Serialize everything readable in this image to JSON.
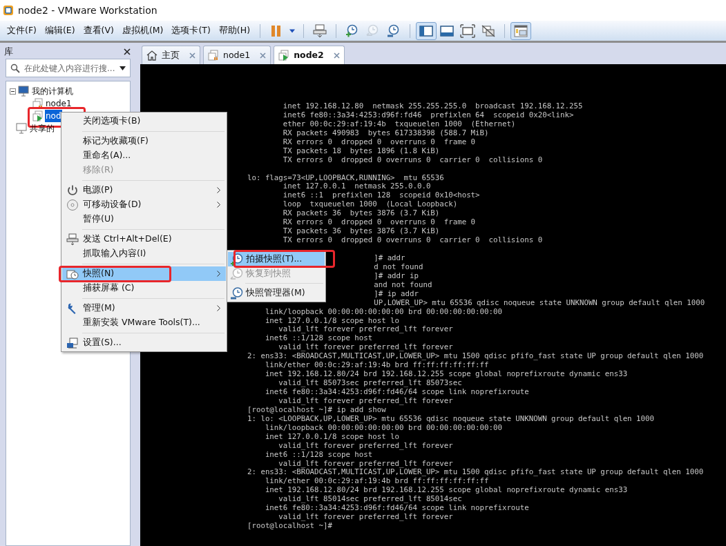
{
  "window": {
    "title": "node2 - VMware Workstation"
  },
  "menu_bar": [
    "文件(F)",
    "编辑(E)",
    "查看(V)",
    "虚拟机(M)",
    "选项卡(T)",
    "帮助(H)"
  ],
  "toolbar_groups": [
    [
      {
        "pressed": false,
        "disabled": false
      },
      {
        "pressed": false,
        "disabled": false
      }
    ],
    [
      {
        "pressed": false,
        "disabled": false
      }
    ],
    [
      {
        "pressed": false,
        "disabled": false
      },
      {
        "pressed": false,
        "disabled": true
      },
      {
        "pressed": false,
        "disabled": false
      }
    ],
    [
      {
        "pressed": true,
        "disabled": false
      },
      {
        "pressed": false,
        "disabled": false
      },
      {
        "pressed": false,
        "disabled": false
      },
      {
        "pressed": false,
        "disabled": false
      }
    ],
    [
      {
        "pressed": true,
        "disabled": false
      }
    ]
  ],
  "library": {
    "title": "库",
    "search": {
      "placeholder": "在此处键入内容进行搜..."
    },
    "tree": [
      {
        "label": "我的计算机",
        "expanded": true,
        "selected": false,
        "highlighted": false,
        "children": [
          {
            "label": "node1",
            "selected": false,
            "highlighted": false,
            "running": false
          },
          {
            "label": "nod",
            "selected": true,
            "highlighted": true,
            "running": true
          }
        ]
      },
      {
        "label": "共享的",
        "selected": false,
        "highlighted": false
      }
    ]
  },
  "tabs": [
    {
      "label": "主页",
      "selected": false
    },
    {
      "label": "node1",
      "selected": false
    },
    {
      "label": "node2",
      "selected": true
    }
  ],
  "terminal": [
    {
      "kind": "line",
      "text": "        inet 192.168.12.80  netmask 255.255.255.0  broadcast 192.168.12.255"
    },
    {
      "kind": "line",
      "text": "        inet6 fe80::3a34:4253:d96f:fd46  prefixlen 64  scopeid 0x20<link>"
    },
    {
      "kind": "line",
      "text": "        ether 00:0c:29:af:19:4b  txqueuelen 1000  (Ethernet)"
    },
    {
      "kind": "line",
      "text": "        RX packets 490983  bytes 617338398 (588.7 MiB)"
    },
    {
      "kind": "line",
      "text": "        RX errors 0  dropped 0  overruns 0  frame 0"
    },
    {
      "kind": "line",
      "text": "        TX packets 18  bytes 1896 (1.8 KiB)"
    },
    {
      "kind": "line",
      "text": "        TX errors 0  dropped 0 overruns 0  carrier 0  collisions 0"
    },
    {
      "kind": "blank"
    },
    {
      "kind": "line",
      "text": "lo: flags=73<UP,LOOPBACK,RUNNING>  mtu 65536"
    },
    {
      "kind": "line",
      "text": "        inet 127.0.0.1  netmask 255.0.0.0"
    },
    {
      "kind": "line",
      "text": "        inet6 ::1  prefixlen 128  scopeid 0x10<host>"
    },
    {
      "kind": "line",
      "text": "        loop  txqueuelen 1000  (Local Loopback)"
    },
    {
      "kind": "line",
      "text": "        RX packets 36  bytes 3876 (3.7 KiB)"
    },
    {
      "kind": "line",
      "text": "        RX errors 0  dropped 0  overruns 0  frame 0"
    },
    {
      "kind": "line",
      "text": "        TX packets 36  bytes 3876 (3.7 KiB)"
    },
    {
      "kind": "line",
      "text": "        TX errors 0  dropped 0 overruns 0  carrier 0  collisions 0"
    },
    {
      "kind": "blank"
    },
    {
      "kind": "covered",
      "text": "]# addr"
    },
    {
      "kind": "covered",
      "text": "d not found"
    },
    {
      "kind": "covered",
      "text": "]# addr ip"
    },
    {
      "kind": "covered",
      "text": "and not found"
    },
    {
      "kind": "covered",
      "text": "]# ip addr"
    },
    {
      "kind": "covered",
      "text": "UP,LOWER_UP> mtu 65536 qdisc noqueue state UNKNOWN group default qlen 1000"
    },
    {
      "kind": "line",
      "text": "    link/loopback 00:00:00:00:00:00 brd 00:00:00:00:00:00"
    },
    {
      "kind": "line",
      "text": "    inet 127.0.0.1/8 scope host lo"
    },
    {
      "kind": "line",
      "text": "       valid_lft forever preferred_lft forever"
    },
    {
      "kind": "line",
      "text": "    inet6 ::1/128 scope host"
    },
    {
      "kind": "line",
      "text": "       valid_lft forever preferred_lft forever"
    },
    {
      "kind": "line",
      "text": "2: ens33: <BROADCAST,MULTICAST,UP,LOWER_UP> mtu 1500 qdisc pfifo_fast state UP group default qlen 1000"
    },
    {
      "kind": "line",
      "text": "    link/ether 00:0c:29:af:19:4b brd ff:ff:ff:ff:ff:ff"
    },
    {
      "kind": "line",
      "text": "    inet 192.168.12.80/24 brd 192.168.12.255 scope global noprefixroute dynamic ens33"
    },
    {
      "kind": "line",
      "text": "       valid_lft 85073sec preferred_lft 85073sec"
    },
    {
      "kind": "line",
      "text": "    inet6 fe80::3a34:4253:d96f:fd46/64 scope link noprefixroute"
    },
    {
      "kind": "line",
      "text": "       valid_lft forever preferred_lft forever"
    },
    {
      "kind": "line",
      "text": "[root@localhost ~]# ip add show"
    },
    {
      "kind": "line",
      "text": "1: lo: <LOOPBACK,UP,LOWER_UP> mtu 65536 qdisc noqueue state UNKNOWN group default qlen 1000"
    },
    {
      "kind": "line",
      "text": "    link/loopback 00:00:00:00:00:00 brd 00:00:00:00:00:00"
    },
    {
      "kind": "line",
      "text": "    inet 127.0.0.1/8 scope host lo"
    },
    {
      "kind": "line",
      "text": "       valid_lft forever preferred_lft forever"
    },
    {
      "kind": "line",
      "text": "    inet6 ::1/128 scope host"
    },
    {
      "kind": "line",
      "text": "       valid_lft forever preferred_lft forever"
    },
    {
      "kind": "line",
      "text": "2: ens33: <BROADCAST,MULTICAST,UP,LOWER_UP> mtu 1500 qdisc pfifo_fast state UP group default qlen 1000"
    },
    {
      "kind": "line",
      "text": "    link/ether 00:0c:29:af:19:4b brd ff:ff:ff:ff:ff:ff"
    },
    {
      "kind": "line",
      "text": "    inet 192.168.12.80/24 brd 192.168.12.255 scope global noprefixroute dynamic ens33"
    },
    {
      "kind": "line",
      "text": "       valid_lft 85014sec preferred_lft 85014sec"
    },
    {
      "kind": "line",
      "text": "    inet6 fe80::3a34:4253:d96f:fd46/64 scope link noprefixroute"
    },
    {
      "kind": "line",
      "text": "       valid_lft forever preferred_lft forever"
    },
    {
      "kind": "line",
      "text": "[root@localhost ~]#"
    }
  ],
  "context_menu": {
    "groups": [
      [
        {
          "label": "关闭选项卡(B)",
          "disabled": false,
          "submenu": false,
          "selected": false,
          "highlighted": false
        }
      ],
      [
        {
          "label": "标记为收藏项(F)",
          "disabled": false,
          "submenu": false,
          "selected": false,
          "highlighted": false
        },
        {
          "label": "重命名(A)...",
          "disabled": false,
          "submenu": false,
          "selected": false,
          "highlighted": false
        },
        {
          "label": "移除(R)",
          "disabled": true,
          "submenu": false,
          "selected": false,
          "highlighted": false
        }
      ],
      [
        {
          "label": "电源(P)",
          "disabled": false,
          "submenu": true,
          "selected": false,
          "highlighted": false
        },
        {
          "label": "可移动设备(D)",
          "disabled": false,
          "submenu": true,
          "selected": false,
          "highlighted": false
        },
        {
          "label": "暂停(U)",
          "disabled": false,
          "submenu": false,
          "selected": false,
          "highlighted": false
        }
      ],
      [
        {
          "label": "发送 Ctrl+Alt+Del(E)",
          "disabled": false,
          "submenu": false,
          "selected": false,
          "highlighted": false
        },
        {
          "label": "抓取输入内容(I)",
          "disabled": false,
          "submenu": false,
          "selected": false,
          "highlighted": false
        }
      ],
      [
        {
          "label": "快照(N)",
          "disabled": false,
          "submenu": true,
          "selected": true,
          "highlighted": true
        },
        {
          "label": "捕获屏幕 (C)",
          "disabled": false,
          "submenu": false,
          "selected": false,
          "highlighted": false
        }
      ],
      [
        {
          "label": "管理(M)",
          "disabled": false,
          "submenu": true,
          "selected": false,
          "highlighted": false
        },
        {
          "label": "重新安装 VMware Tools(T)...",
          "disabled": false,
          "submenu": false,
          "selected": false,
          "highlighted": false
        }
      ],
      [
        {
          "label": "设置(S)...",
          "disabled": false,
          "submenu": false,
          "selected": false,
          "highlighted": false
        }
      ]
    ]
  },
  "snapshot_menu": {
    "groups": [
      [
        {
          "label": "拍摄快照(T)...",
          "disabled": false,
          "selected": true,
          "highlighted": true
        },
        {
          "label": "恢复到快照",
          "disabled": true,
          "selected": false,
          "highlighted": false
        }
      ],
      [
        {
          "label": "快照管理器(M)",
          "disabled": false,
          "selected": false,
          "highlighted": false
        }
      ]
    ]
  }
}
